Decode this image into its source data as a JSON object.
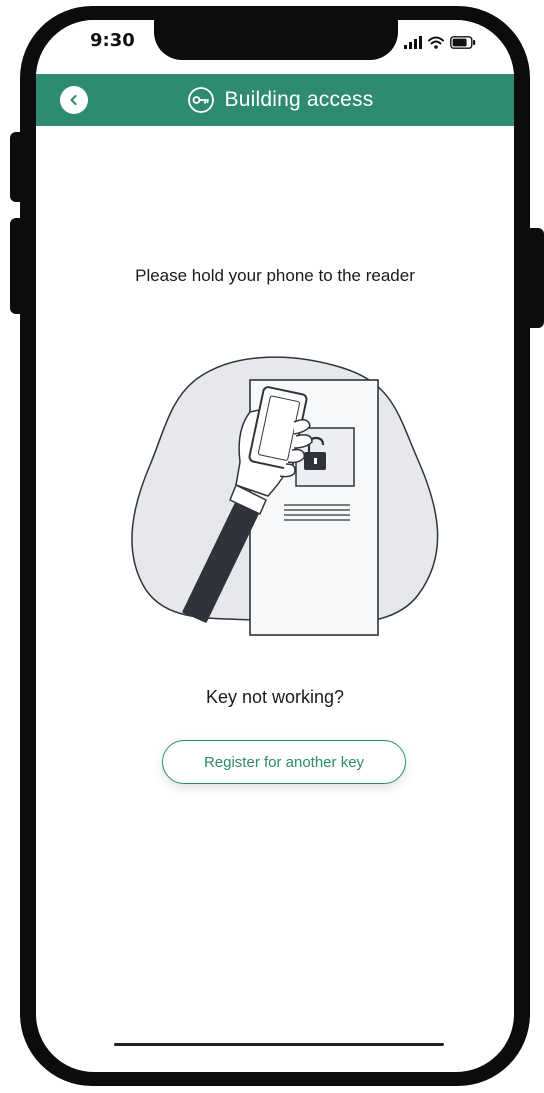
{
  "status_bar": {
    "time": "9:30"
  },
  "header": {
    "title": "Building access",
    "back_icon": "chevron-left-icon",
    "title_icon": "key-icon"
  },
  "main": {
    "instruction": "Please hold your phone to the reader",
    "illustration": "phone-to-reader-illustration",
    "key_question": "Key not working?",
    "register_button_label": "Register for another key"
  },
  "colors": {
    "header_bg": "#2e8a70",
    "accent": "#2e8a70",
    "text": "#1a1a1a",
    "illustration_fill": "#e6e8ec",
    "illustration_dark": "#2f343b"
  }
}
